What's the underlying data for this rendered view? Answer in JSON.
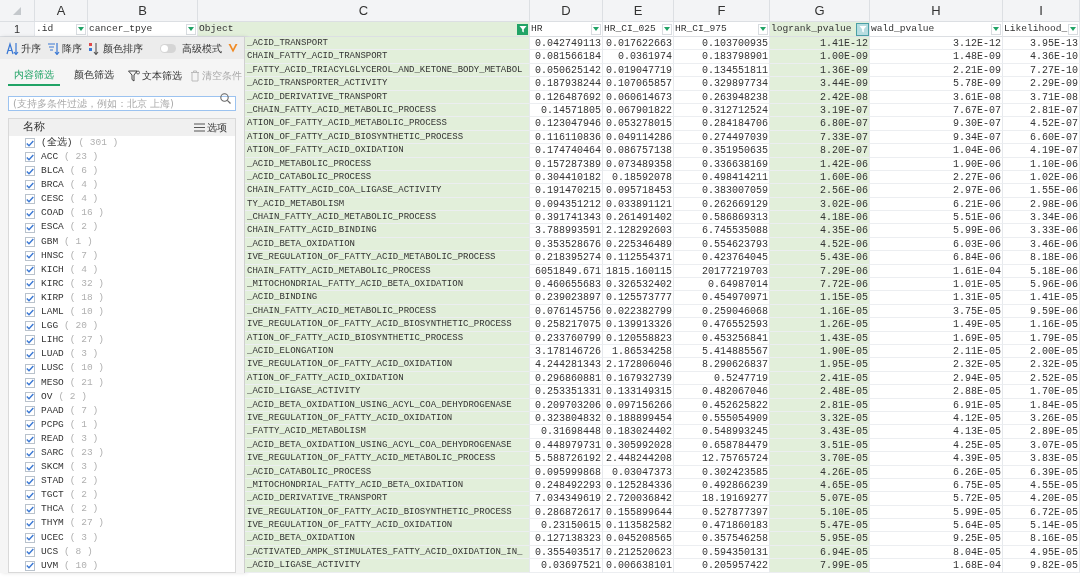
{
  "columns": [
    {
      "letter": "A",
      "header": ".id",
      "kind": "dropdown",
      "highlighted": false
    },
    {
      "letter": "B",
      "header": "cancer_tpye",
      "kind": "dropdown",
      "highlighted": false
    },
    {
      "letter": "C",
      "header": "Object",
      "kind": "filtered",
      "highlighted": true
    },
    {
      "letter": "D",
      "header": "HR",
      "kind": "dropdown",
      "highlighted": false
    },
    {
      "letter": "E",
      "header": "HR_CI_025",
      "kind": "dropdown",
      "highlighted": false
    },
    {
      "letter": "F",
      "header": "HR_CI_975",
      "kind": "dropdown",
      "highlighted": false
    },
    {
      "letter": "G",
      "header": "logrank_pvalue",
      "kind": "filtered",
      "highlighted": true
    },
    {
      "letter": "H",
      "header": "wald_pvalue",
      "kind": "dropdown",
      "highlighted": false
    },
    {
      "letter": "I",
      "header": "Likelihood_",
      "kind": "dropdown",
      "highlighted": false
    }
  ],
  "header_row_number": "1",
  "rows": [
    [
      "_ACID_TRANSPORT",
      "0.042749113",
      "0.017622663",
      "0.103700935",
      "1.41E-12",
      "3.12E-12",
      "3.95E-13"
    ],
    [
      "CHAIN_FATTY_ACID_TRANSPORT",
      "0.081566184",
      "0.0361974",
      "0.183798901",
      "1.00E-09",
      "1.48E-09",
      "4.36E-10"
    ],
    [
      "_FATTY_ACID_TRIACYLGLYCEROL_AND_KETONE_BODY_METABOL",
      "0.050625142",
      "0.019047719",
      "0.134551811",
      "1.36E-09",
      "2.21E-09",
      "7.27E-10"
    ],
    [
      "_ACID_TRANSPORTER_ACTIVITY",
      "0.187938244",
      "0.107065857",
      "0.329897734",
      "3.44E-09",
      "5.78E-09",
      "2.29E-09"
    ],
    [
      "_ACID_DERIVATIVE_TRANSPORT",
      "0.126487692",
      "0.060614673",
      "0.263948238",
      "2.42E-08",
      "3.61E-08",
      "3.71E-08"
    ],
    [
      "_CHAIN_FATTY_ACID_METABOLIC_PROCESS",
      "0.14571805",
      "0.067901822",
      "0.312712524",
      "3.19E-07",
      "7.67E-07",
      "2.81E-07"
    ],
    [
      "ATION_OF_FATTY_ACID_METABOLIC_PROCESS",
      "0.123047946",
      "0.053278015",
      "0.284184706",
      "6.80E-07",
      "9.30E-07",
      "4.52E-07"
    ],
    [
      "ATION_OF_FATTY_ACID_BIOSYNTHETIC_PROCESS",
      "0.116110836",
      "0.049114286",
      "0.274497039",
      "7.33E-07",
      "9.34E-07",
      "6.60E-07"
    ],
    [
      "ATION_OF_FATTY_ACID_OXIDATION",
      "0.174740464",
      "0.086757138",
      "0.351950635",
      "8.20E-07",
      "1.04E-06",
      "4.19E-07"
    ],
    [
      "_ACID_METABOLIC_PROCESS",
      "0.157287389",
      "0.073489358",
      "0.336638169",
      "1.42E-06",
      "1.90E-06",
      "1.10E-06"
    ],
    [
      "_ACID_CATABOLIC_PROCESS",
      "0.304410182",
      "0.18592078",
      "0.498414211",
      "1.60E-06",
      "2.27E-06",
      "1.02E-06"
    ],
    [
      "CHAIN_FATTY_ACID_COA_LIGASE_ACTIVITY",
      "0.191470215",
      "0.095718453",
      "0.383007059",
      "2.56E-06",
      "2.97E-06",
      "1.55E-06"
    ],
    [
      "TY_ACID_METABOLISM",
      "0.094351212",
      "0.033891121",
      "0.262669129",
      "3.02E-06",
      "6.21E-06",
      "2.98E-06"
    ],
    [
      "_CHAIN_FATTY_ACID_METABOLIC_PROCESS",
      "0.391741343",
      "0.261491402",
      "0.586869313",
      "4.18E-06",
      "5.51E-06",
      "3.34E-06"
    ],
    [
      "CHAIN_FATTY_ACID_BINDING",
      "3.788993591",
      "2.128292603",
      "6.745535088",
      "4.35E-06",
      "5.99E-06",
      "3.33E-06"
    ],
    [
      "_ACID_BETA_OXIDATION",
      "0.353528676",
      "0.225346489",
      "0.554623793",
      "4.52E-06",
      "6.03E-06",
      "3.46E-06"
    ],
    [
      "IVE_REGULATION_OF_FATTY_ACID_METABOLIC_PROCESS",
      "0.218395274",
      "0.112554371",
      "0.423764045",
      "5.43E-06",
      "6.84E-06",
      "8.18E-06"
    ],
    [
      "CHAIN_FATTY_ACID_METABOLIC_PROCESS",
      "6051849.671",
      "1815.160115",
      "20177219703",
      "7.29E-06",
      "1.61E-04",
      "5.18E-06"
    ],
    [
      "_MITOCHONDRIAL_FATTY_ACID_BETA_OXIDATION",
      "0.460655683",
      "0.326532402",
      "0.64987014",
      "7.72E-06",
      "1.01E-05",
      "5.96E-06"
    ],
    [
      "_ACID_BINDING",
      "0.239023897",
      "0.125573777",
      "0.454970971",
      "1.15E-05",
      "1.31E-05",
      "1.41E-05"
    ],
    [
      "_CHAIN_FATTY_ACID_METABOLIC_PROCESS",
      "0.076145756",
      "0.022382799",
      "0.259046068",
      "1.16E-05",
      "3.75E-05",
      "9.59E-06"
    ],
    [
      "IVE_REGULATION_OF_FATTY_ACID_BIOSYNTHETIC_PROCESS",
      "0.258217075",
      "0.139913326",
      "0.476552593",
      "1.26E-05",
      "1.49E-05",
      "1.16E-05"
    ],
    [
      "ATION_OF_FATTY_ACID_BIOSYNTHETIC_PROCESS",
      "0.233760799",
      "0.120558823",
      "0.453256841",
      "1.43E-05",
      "1.69E-05",
      "1.79E-05"
    ],
    [
      "_ACID_ELONGATION",
      "3.178146726",
      "1.86534258",
      "5.414885567",
      "1.90E-05",
      "2.11E-05",
      "2.00E-05"
    ],
    [
      "IVE_REGULATION_OF_FATTY_ACID_OXIDATION",
      "4.244281343",
      "2.172806046",
      "8.290626837",
      "1.95E-05",
      "2.32E-05",
      "2.32E-05"
    ],
    [
      "ATION_OF_FATTY_ACID_OXIDATION",
      "0.296860881",
      "0.167932739",
      "0.5247719",
      "2.41E-05",
      "2.94E-05",
      "2.52E-05"
    ],
    [
      "_ACID_LIGASE_ACTIVITY",
      "0.253351331",
      "0.133149315",
      "0.482067046",
      "2.48E-05",
      "2.88E-05",
      "1.70E-05"
    ],
    [
      "_ACID_BETA_OXIDATION_USING_ACYL_COA_DEHYDROGENASE",
      "0.209703206",
      "0.097156266",
      "0.452625822",
      "2.81E-05",
      "6.91E-05",
      "1.84E-05"
    ],
    [
      "IVE_REGULATION_OF_FATTY_ACID_OXIDATION",
      "0.323804832",
      "0.188899454",
      "0.555054909",
      "3.32E-05",
      "4.12E-05",
      "3.26E-05"
    ],
    [
      "_FATTY_ACID_METABOLISM",
      "0.31698448",
      "0.183024402",
      "0.548993245",
      "3.43E-05",
      "4.13E-05",
      "2.89E-05"
    ],
    [
      "_ACID_BETA_OXIDATION_USING_ACYL_COA_DEHYDROGENASE",
      "0.448979731",
      "0.305992028",
      "0.658784479",
      "3.51E-05",
      "4.25E-05",
      "3.07E-05"
    ],
    [
      "IVE_REGULATION_OF_FATTY_ACID_METABOLIC_PROCESS",
      "5.588726192",
      "2.448244208",
      "12.75765724",
      "3.70E-05",
      "4.39E-05",
      "3.83E-05"
    ],
    [
      "_ACID_CATABOLIC_PROCESS",
      "0.095999868",
      "0.03047373",
      "0.302423585",
      "4.26E-05",
      "6.26E-05",
      "6.39E-05"
    ],
    [
      "_MITOCHONDRIAL_FATTY_ACID_BETA_OXIDATION",
      "0.248492293",
      "0.125284336",
      "0.492866239",
      "4.65E-05",
      "6.75E-05",
      "4.55E-05"
    ],
    [
      "_ACID_DERIVATIVE_TRANSPORT",
      "7.034349619",
      "2.720036842",
      "18.19169277",
      "5.07E-05",
      "5.72E-05",
      "4.20E-05"
    ],
    [
      "IVE_REGULATION_OF_FATTY_ACID_BIOSYNTHETIC_PROCESS",
      "0.286872617",
      "0.155899644",
      "0.527877397",
      "5.10E-05",
      "5.99E-05",
      "6.72E-05"
    ],
    [
      "IVE_REGULATION_OF_FATTY_ACID_OXIDATION",
      "0.23150615",
      "0.113582582",
      "0.471860183",
      "5.47E-05",
      "5.64E-05",
      "5.14E-05"
    ],
    [
      "_ACID_BETA_OXIDATION",
      "0.127138323",
      "0.045208565",
      "0.357546258",
      "5.95E-05",
      "9.25E-05",
      "8.16E-05"
    ],
    [
      "_ACTIVATED_AMPK_STIMULATES_FATTY_ACID_OXIDATION_IN_",
      "0.355403517",
      "0.212520623",
      "0.594350131",
      "6.94E-05",
      "8.04E-05",
      "4.95E-05"
    ],
    [
      "_ACID_LIGASE_ACTIVITY",
      "0.03697521",
      "0.006638101",
      "0.205957422",
      "7.99E-05",
      "1.68E-04",
      "9.82E-05"
    ]
  ],
  "filter_panel": {
    "sort_buttons": [
      {
        "kind": "ascending",
        "label": "升序"
      },
      {
        "kind": "descending",
        "label": "降序"
      },
      {
        "kind": "color",
        "label": "颜色排序"
      }
    ],
    "advanced_mode": {
      "label": "高级模式",
      "on": false
    },
    "tabs": [
      {
        "label": "内容筛选",
        "selected": true
      },
      {
        "label": "颜色筛选",
        "selected": false
      }
    ],
    "text_filter": "文本筛选",
    "clear": {
      "label": "清空条件",
      "disabled": true
    },
    "search": {
      "placeholder": "(支持多条件过滤，例如：北京 上海)"
    },
    "list_header": "名称",
    "options_button": "选项",
    "items": [
      {
        "label": "(全选)",
        "count": "( 301 )",
        "checked": true
      },
      {
        "label": "ACC",
        "count": "( 23 )",
        "checked": true
      },
      {
        "label": "BLCA",
        "count": "( 6 )",
        "checked": true
      },
      {
        "label": "BRCA",
        "count": "( 4 )",
        "checked": true
      },
      {
        "label": "CESC",
        "count": "( 4 )",
        "checked": true
      },
      {
        "label": "COAD",
        "count": "( 16 )",
        "checked": true
      },
      {
        "label": "ESCA",
        "count": "( 2 )",
        "checked": true
      },
      {
        "label": "GBM",
        "count": "( 1 )",
        "checked": true
      },
      {
        "label": "HNSC",
        "count": "( 7 )",
        "checked": true
      },
      {
        "label": "KICH",
        "count": "( 4 )",
        "checked": true
      },
      {
        "label": "KIRC",
        "count": "( 32 )",
        "checked": true
      },
      {
        "label": "KIRP",
        "count": "( 18 )",
        "checked": true
      },
      {
        "label": "LAML",
        "count": "( 10 )",
        "checked": true
      },
      {
        "label": "LGG",
        "count": "( 20 )",
        "checked": true
      },
      {
        "label": "LIHC",
        "count": "( 27 )",
        "checked": true
      },
      {
        "label": "LUAD",
        "count": "( 3 )",
        "checked": true
      },
      {
        "label": "LUSC",
        "count": "( 10 )",
        "checked": true
      },
      {
        "label": "MESO",
        "count": "( 21 )",
        "checked": true
      },
      {
        "label": "OV",
        "count": "( 2 )",
        "checked": true
      },
      {
        "label": "PAAD",
        "count": "( 7 )",
        "checked": true
      },
      {
        "label": "PCPG",
        "count": "( 1 )",
        "checked": true
      },
      {
        "label": "READ",
        "count": "( 3 )",
        "checked": true
      },
      {
        "label": "SARC",
        "count": "( 23 )",
        "checked": true
      },
      {
        "label": "SKCM",
        "count": "( 3 )",
        "checked": true
      },
      {
        "label": "STAD",
        "count": "( 2 )",
        "checked": true
      },
      {
        "label": "TGCT",
        "count": "( 2 )",
        "checked": true
      },
      {
        "label": "THCA",
        "count": "( 2 )",
        "checked": true
      },
      {
        "label": "THYM",
        "count": "( 27 )",
        "checked": true
      },
      {
        "label": "UCEC",
        "count": "( 3 )",
        "checked": true
      },
      {
        "label": "UCS",
        "count": "( 8 )",
        "checked": true
      },
      {
        "label": "UVM",
        "count": "( 10 )",
        "checked": true
      }
    ]
  }
}
